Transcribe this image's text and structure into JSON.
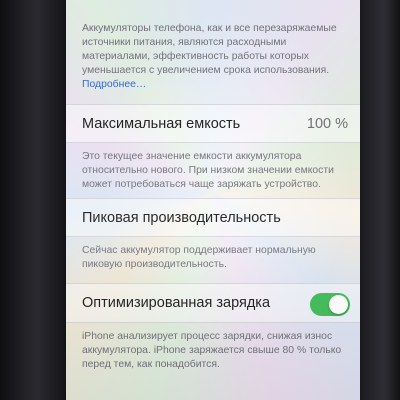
{
  "intro": {
    "text": "Аккумуляторы телефона, как и все перезаряжаемые источники питания, являются расходными материалами, эффективность работы которых уменьшается с увеличением срока использования.",
    "link": "Подробнее…"
  },
  "max_capacity": {
    "label": "Максимальная емкость",
    "value": "100 %",
    "note": "Это текущее значение емкости аккумулятора относительно нового. При низком значении емкости может потребоваться чаще заряжать устройство."
  },
  "peak_performance": {
    "label": "Пиковая производительность",
    "note": "Сейчас аккумулятор поддерживает нормальную пиковую производительность."
  },
  "optimized_charging": {
    "label": "Оптимизированная зарядка",
    "enabled": true,
    "note": "iPhone анализирует процесс зарядки, снижая износ аккумулятора. iPhone заряжается свыше 80 % только перед тем, как понадобится."
  },
  "colors": {
    "toggle_on": "#3dbb55",
    "link": "#2b66d9"
  }
}
